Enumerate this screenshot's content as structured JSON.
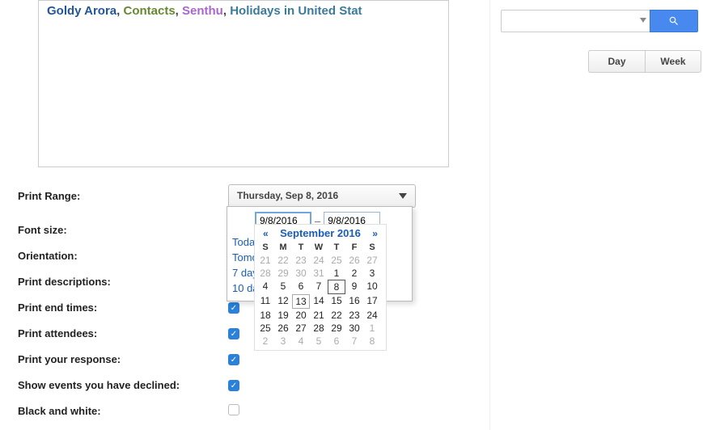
{
  "preview": {
    "c1": "Goldy Arora",
    "c2": "Contacts",
    "c3": "Senthu",
    "c4": "Holidays in United Stat"
  },
  "settings": {
    "print_range_label": "Print Range:",
    "font_size_label": "Font size:",
    "orientation_label": "Orientation:",
    "print_descriptions_label": "Print descriptions:",
    "print_end_times_label": "Print end times:",
    "print_attendees_label": "Print attendees:",
    "print_your_response_label": "Print your response:",
    "show_declined_label": "Show events you have declined:",
    "black_and_white_label": "Black and white:",
    "range_value": "Thursday, Sep 8, 2016",
    "print_end_times": true,
    "print_attendees": true,
    "print_your_response": true,
    "show_declined": true,
    "black_and_white": false
  },
  "popup": {
    "start_date": "9/8/2016",
    "end_date": "9/8/2016",
    "today": "Toda",
    "tomorrow": "Tomo",
    "seven_days": "7 day",
    "ten_days": "10 da"
  },
  "calendar": {
    "prev": "«",
    "next": "»",
    "title": "September 2016",
    "dow": [
      "S",
      "M",
      "T",
      "W",
      "T",
      "F",
      "S"
    ],
    "cells": [
      {
        "n": 21,
        "m": true
      },
      {
        "n": 22,
        "m": true
      },
      {
        "n": 23,
        "m": true
      },
      {
        "n": 24,
        "m": true
      },
      {
        "n": 25,
        "m": true
      },
      {
        "n": 26,
        "m": true
      },
      {
        "n": 27,
        "m": true
      },
      {
        "n": 28,
        "m": true
      },
      {
        "n": 29,
        "m": true
      },
      {
        "n": 30,
        "m": true
      },
      {
        "n": 31,
        "m": true
      },
      {
        "n": 1
      },
      {
        "n": 2
      },
      {
        "n": 3
      },
      {
        "n": 4
      },
      {
        "n": 5
      },
      {
        "n": 6
      },
      {
        "n": 7
      },
      {
        "n": 8,
        "today": true
      },
      {
        "n": 9
      },
      {
        "n": 10
      },
      {
        "n": 11
      },
      {
        "n": 12
      },
      {
        "n": 13,
        "hover": true
      },
      {
        "n": 14
      },
      {
        "n": 15
      },
      {
        "n": 16
      },
      {
        "n": 17
      },
      {
        "n": 18
      },
      {
        "n": 19
      },
      {
        "n": 20
      },
      {
        "n": 21
      },
      {
        "n": 22
      },
      {
        "n": 23
      },
      {
        "n": 24
      },
      {
        "n": 25
      },
      {
        "n": 26
      },
      {
        "n": 27
      },
      {
        "n": 28
      },
      {
        "n": 29
      },
      {
        "n": 30
      },
      {
        "n": 1,
        "m": true
      },
      {
        "n": 2,
        "m": true
      },
      {
        "n": 3,
        "m": true
      },
      {
        "n": 4,
        "m": true
      },
      {
        "n": 5,
        "m": true
      },
      {
        "n": 6,
        "m": true
      },
      {
        "n": 7,
        "m": true
      },
      {
        "n": 8,
        "m": true
      }
    ]
  },
  "right": {
    "day": "Day",
    "week": "Week"
  }
}
